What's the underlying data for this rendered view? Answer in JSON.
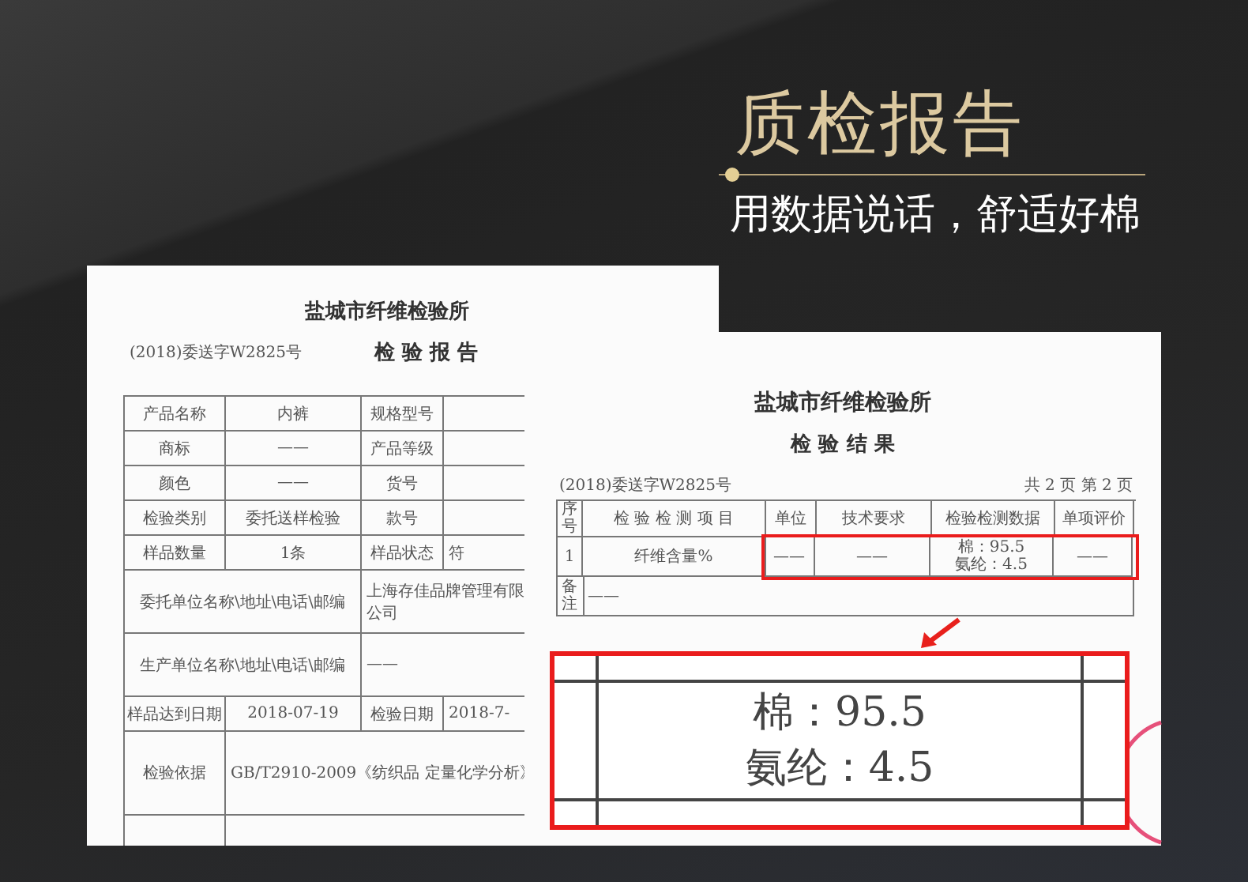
{
  "heading": {
    "title": "质检报告",
    "subtitle": "用数据说话，舒适好棉"
  },
  "report_cover": {
    "institute": "盐城市纤维检验所",
    "title": "检 验 报 告",
    "reference": "(2018)委送字W2825号",
    "rows": [
      {
        "kind": "quad",
        "cells": [
          "产品名称",
          "内裤",
          "规格型号",
          ""
        ]
      },
      {
        "kind": "quad",
        "cells": [
          "商标",
          "——",
          "产品等级",
          ""
        ]
      },
      {
        "kind": "quad",
        "cells": [
          "颜色",
          "——",
          "货号",
          ""
        ]
      },
      {
        "kind": "quad",
        "cells": [
          "检验类别",
          "委托送样检验",
          "款号",
          ""
        ]
      },
      {
        "kind": "quad",
        "cells": [
          "样品数量",
          "1条",
          "样品状态",
          "符"
        ]
      },
      {
        "kind": "pair",
        "cells": [
          "委托单位名称\\地址\\电话\\邮编",
          "上海存佳品牌管理有限公司"
        ]
      },
      {
        "kind": "pair",
        "cells": [
          "生产单位名称\\地址\\电话\\邮编",
          "——"
        ]
      },
      {
        "kind": "quad",
        "cells": [
          "样品达到日期",
          "2018-07-19",
          "检验日期",
          "2018-7-"
        ]
      },
      {
        "kind": "wide",
        "cells": [
          "检验依据",
          "GB/T2910-2009《纺织品 定量化学分析》"
        ]
      }
    ]
  },
  "result_page": {
    "institute": "盐城市纤维检验所",
    "title": "检 验 结 果",
    "reference": "(2018)委送字W2825号",
    "page": "共 2 页 第 2 页",
    "columns": [
      "序号",
      "检 验 检 测 项 目",
      "单位",
      "技术要求",
      "检验检测数据",
      "单项评价"
    ],
    "rows": [
      {
        "number": "1",
        "item": "纤维含量%",
        "unit": "——",
        "requirement": "——",
        "data": [
          "棉：95.5",
          "氨纶：4.5"
        ],
        "evaluation": "——",
        "highlighted": true
      }
    ],
    "remarks_label": "备注",
    "remarks": "——"
  },
  "magnified": {
    "lines": [
      "棉：95.5",
      "氨纶：4.5"
    ]
  }
}
